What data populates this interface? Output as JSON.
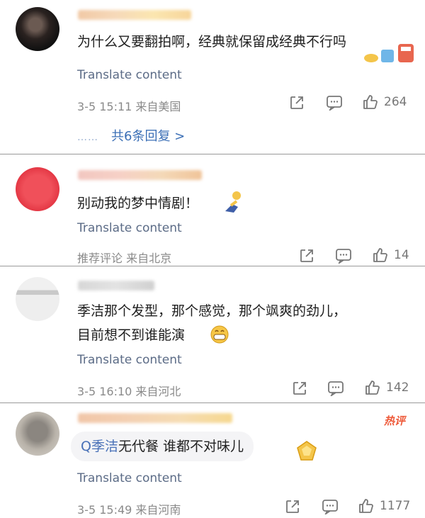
{
  "comments": [
    {
      "text": "为什么又要翻拍啊，经典就保留成经典不行吗",
      "translate": "Translate content",
      "meta": "3-5 15:11 来自美国",
      "likes": "264",
      "replies": "共6条回复 >",
      "reply_dots": "……"
    },
    {
      "text": "别动我的梦中情剧！",
      "translate": "Translate content",
      "meta": "推荐评论 来自北京",
      "likes": "14"
    },
    {
      "text_line1": "季洁那个发型，那个感觉，那个飒爽的劲儿，",
      "text_line2": "目前想不到谁能演",
      "translate": "Translate content",
      "meta": "3-5 16:10 来自河北",
      "likes": "142"
    },
    {
      "topic": "Q季洁",
      "text": "无代餐  谁都不对味儿",
      "translate": "Translate content",
      "meta": "3-5 15:49 来自河南",
      "likes": "1177",
      "badge": "热评"
    }
  ],
  "icons": {
    "share": "share-icon",
    "comment": "comment-icon",
    "like": "thumbs-up-icon"
  },
  "colors": {
    "link": "#5b6b86",
    "meta": "#8a8a8a",
    "hot": "#ee5a3a"
  }
}
